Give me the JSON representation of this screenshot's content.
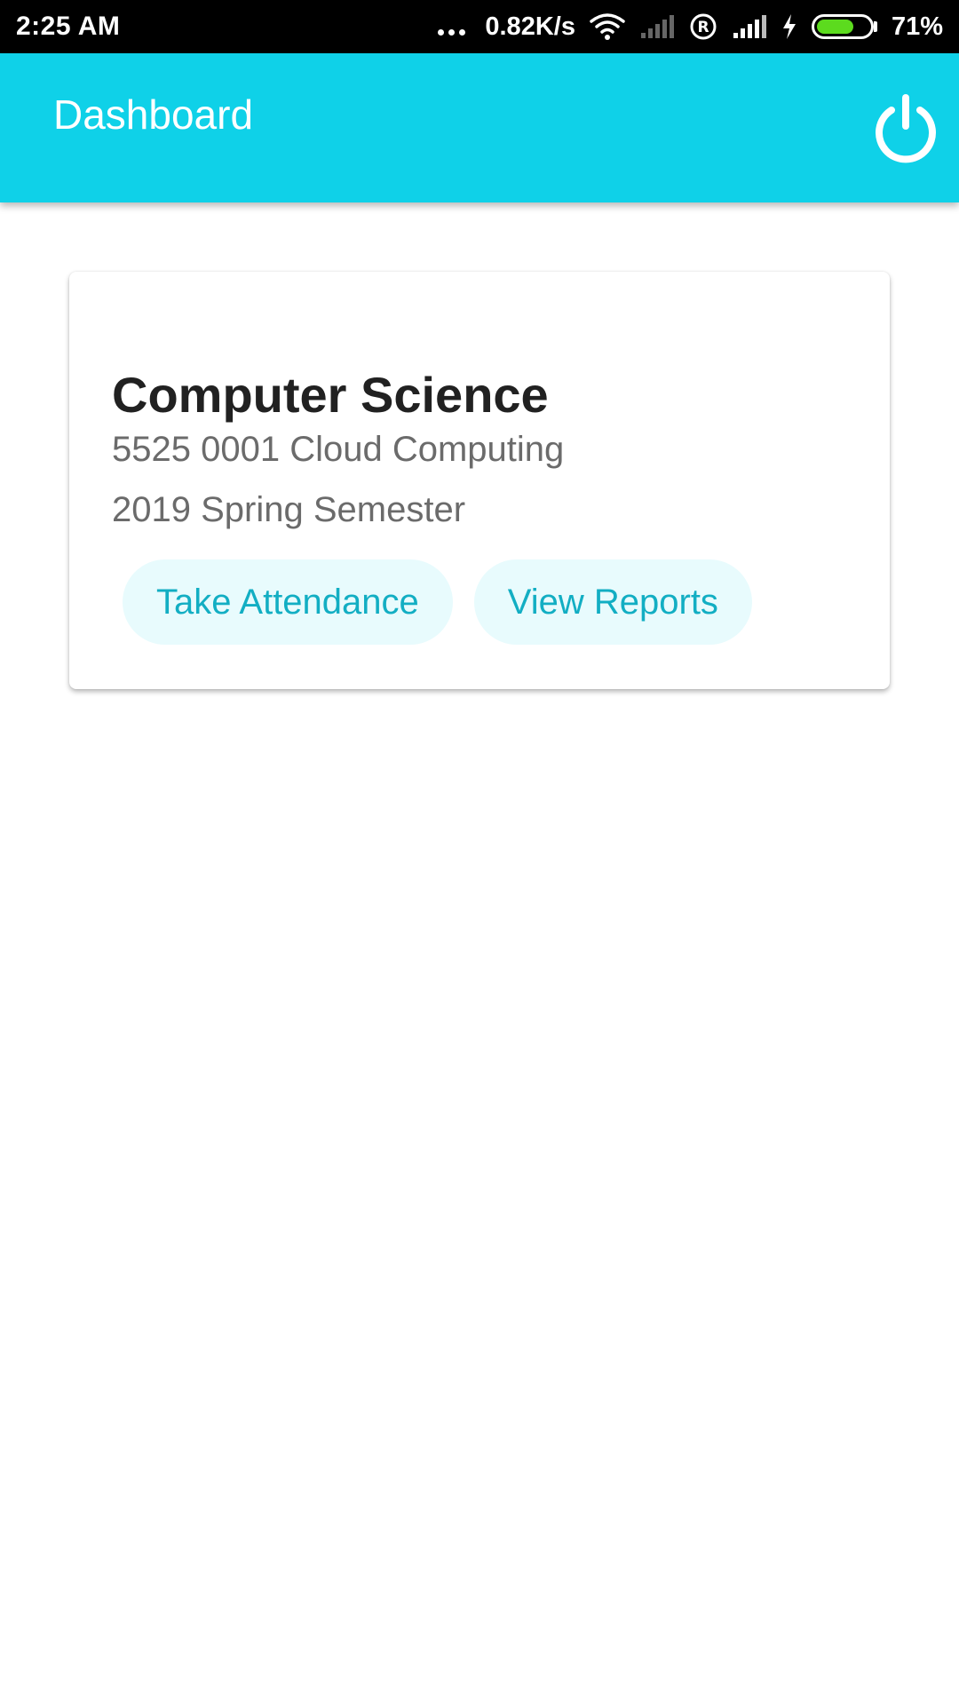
{
  "status_bar": {
    "time": "2:25 AM",
    "network_speed": "0.82K/s",
    "battery_percent": "71%",
    "battery_level": 0.71,
    "icons": [
      "more-dots-icon",
      "wifi-icon",
      "signal-weak-icon",
      "roaming-icon",
      "signal-icon",
      "charging-icon",
      "battery-icon"
    ]
  },
  "app_bar": {
    "title": "Dashboard",
    "action_icon": "power-icon",
    "color": "#0fd1e8"
  },
  "course_card": {
    "department": "Computer Science",
    "course": "5525 0001 Cloud Computing",
    "semester": "2019 Spring Semester",
    "actions": {
      "take_attendance": "Take Attendance",
      "view_reports": "View Reports"
    },
    "accent_color": "#12aec3"
  }
}
